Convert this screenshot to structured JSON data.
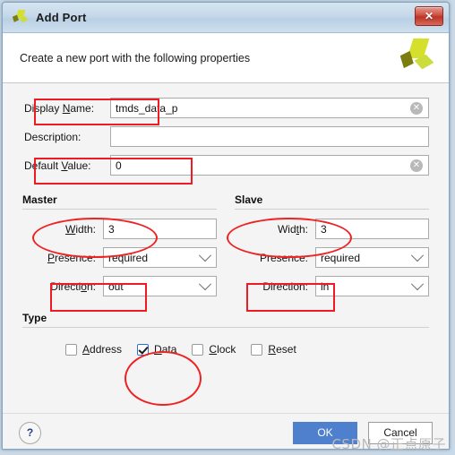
{
  "window": {
    "title": "Add Port",
    "logo_icon": "xilinx-logo-icon",
    "close_label": "✕"
  },
  "header": {
    "description": "Create a new port with the following properties",
    "logo_icon": "xilinx-logo-icon"
  },
  "form": {
    "display_name": {
      "label_pre": "Display ",
      "label_mnemonic": "N",
      "label_post": "ame:",
      "value": "tmds_data_p",
      "clear_icon": "✕"
    },
    "description": {
      "label_pre": "Description:",
      "label_mnemonic": "",
      "label_post": "",
      "value": ""
    },
    "default_value": {
      "label_pre": "Default ",
      "label_mnemonic": "V",
      "label_post": "alue:",
      "value": "0",
      "clear_icon": "✕"
    }
  },
  "master": {
    "title": "Master",
    "width": {
      "label_pre": "",
      "label_mnemonic": "W",
      "label_post": "idth:",
      "value": "3"
    },
    "presence": {
      "label_pre": "",
      "label_mnemonic": "P",
      "label_post": "resence:",
      "value": "required"
    },
    "direction": {
      "label_pre": "Directi",
      "label_mnemonic": "o",
      "label_post": "n:",
      "value": "out"
    }
  },
  "slave": {
    "title": "Slave",
    "width": {
      "label_pre": "Wid",
      "label_mnemonic": "t",
      "label_post": "h:",
      "value": "3"
    },
    "presence": {
      "label_pre": "Presence:",
      "label_mnemonic": "",
      "label_post": "",
      "value": "required"
    },
    "direction": {
      "label_pre": "Direction:",
      "label_mnemonic": "",
      "label_post": "",
      "value": "in"
    }
  },
  "type": {
    "title": "Type",
    "options": [
      {
        "label_pre": "",
        "label_mnemonic": "A",
        "label_post": "ddress",
        "checked": false
      },
      {
        "label_pre": "",
        "label_mnemonic": "D",
        "label_post": "ata",
        "checked": true
      },
      {
        "label_pre": "",
        "label_mnemonic": "C",
        "label_post": "lock",
        "checked": false
      },
      {
        "label_pre": "",
        "label_mnemonic": "R",
        "label_post": "eset",
        "checked": false
      }
    ]
  },
  "footer": {
    "help_label": "?",
    "ok_label": "OK",
    "cancel_label": "Cancel"
  },
  "watermark": "CSDN @正点原子",
  "colors": {
    "accent_blue": "#4f80ce",
    "annotation_red": "#ee1b22",
    "logo_green": "#ccdc3c",
    "logo_dark_green": "#7b7d10"
  }
}
